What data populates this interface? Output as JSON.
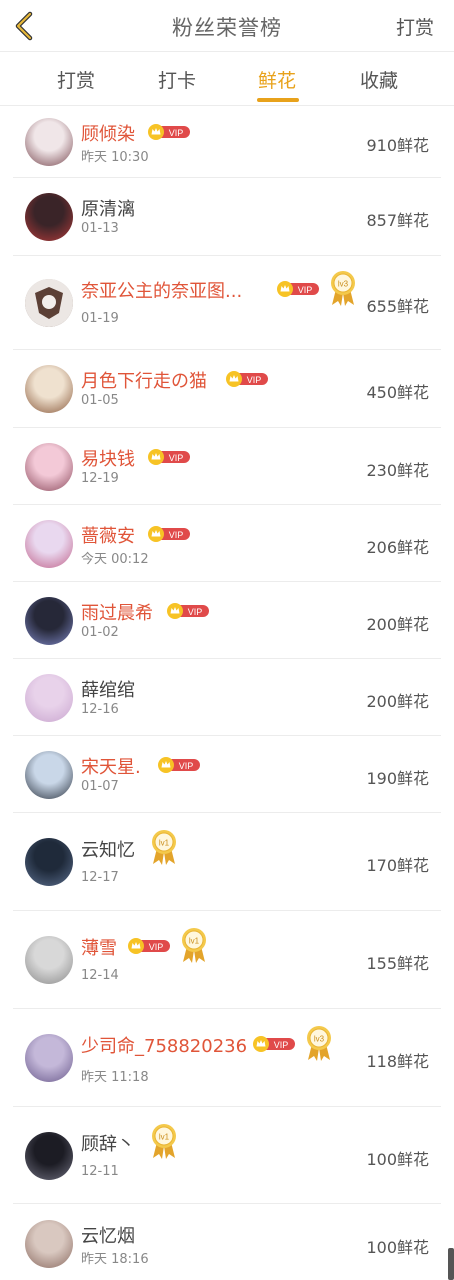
{
  "header": {
    "title": "粉丝荣誉榜",
    "action": "打赏"
  },
  "tabs": [
    {
      "label": "打赏"
    },
    {
      "label": "打卡"
    },
    {
      "label": "鲜花"
    },
    {
      "label": "收藏"
    }
  ],
  "active_tab": "鲜花",
  "colors": {
    "accent": "#e8a21b",
    "vip_name": "#e05539",
    "vip_badge": "#e04a4a"
  },
  "vip_label": "VIP",
  "rows": [
    {
      "name": "顾倾染",
      "date": "昨天 10:30",
      "amount": "910鲜花",
      "vip": true
    },
    {
      "name": "原清漓",
      "date": "01-13",
      "amount": "857鲜花",
      "vip": false
    },
    {
      "name": "奈亚公主的奈亚图...",
      "date": "01-19",
      "amount": "655鲜花",
      "vip": true,
      "medal": "lv3"
    },
    {
      "name": "月色下行走の猫",
      "date": "01-05",
      "amount": "450鲜花",
      "vip": true
    },
    {
      "name": "易块钱",
      "date": "12-19",
      "amount": "230鲜花",
      "vip": true
    },
    {
      "name": "蔷薇安",
      "date": "今天 00:12",
      "amount": "206鲜花",
      "vip": true
    },
    {
      "name": "雨过晨希",
      "date": "01-02",
      "amount": "200鲜花",
      "vip": true
    },
    {
      "name": "薛绾绾",
      "date": "12-16",
      "amount": "200鲜花",
      "vip": false
    },
    {
      "name": "宋天星.",
      "date": "01-07",
      "amount": "190鲜花",
      "vip": true
    },
    {
      "name": "云知忆",
      "date": "12-17",
      "amount": "170鲜花",
      "vip": false,
      "medal": "lv1"
    },
    {
      "name": "薄雪",
      "date": "12-14",
      "amount": "155鲜花",
      "vip": true,
      "medal": "lv1"
    },
    {
      "name": "少司命_758820236",
      "date": "昨天 11:18",
      "amount": "118鲜花",
      "vip": true,
      "medal": "lv3"
    },
    {
      "name": "顾辞丶",
      "date": "12-11",
      "amount": "100鲜花",
      "vip": false,
      "medal": "lv1"
    },
    {
      "name": "云忆烟",
      "date": "昨天 18:16",
      "amount": "100鲜花",
      "vip": false
    }
  ]
}
